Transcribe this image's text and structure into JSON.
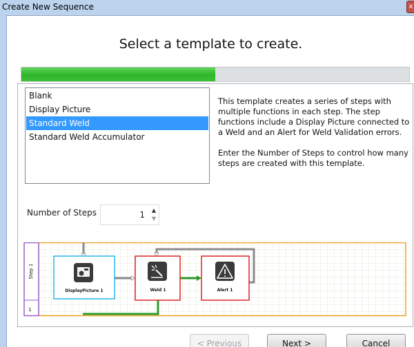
{
  "window": {
    "title": "Create New Sequence",
    "close_glyph": "x"
  },
  "heading": "Select a template to create.",
  "progress": {
    "value": 0.5
  },
  "templates": {
    "items": [
      {
        "label": "Blank"
      },
      {
        "label": "Display Picture"
      },
      {
        "label": "Standard Weld"
      },
      {
        "label": "Standard Weld Accumulator"
      }
    ],
    "selected": "Standard Weld"
  },
  "description": {
    "paragraph1": "This template creates a series of steps with multiple functions in each step.  The step functions include a Display Picture connected to a Weld and an Alert for Weld Validation errors.",
    "paragraph2": "Enter the Number of Steps to control how many steps are created with this template."
  },
  "steps": {
    "label": "Number of Steps",
    "value": "1",
    "up_glyph": "▲",
    "down_glyph": "▼"
  },
  "diagram": {
    "step_label": "Step 1",
    "step_number": "1",
    "nodes": [
      {
        "label": "DisplayPicture 1",
        "icon": "camera-icon",
        "border_color": "#29b6e8"
      },
      {
        "label": "Weld 1",
        "icon": "weld-icon",
        "border_color": "#e02020"
      },
      {
        "label": "Alert 1",
        "icon": "warning-icon",
        "border_color": "#e02020"
      }
    ],
    "colors": {
      "step_band": "#9a5ec7",
      "lane_border": "#f0a020",
      "grid": "#e3ebd6",
      "success_link": "#2a9a2a",
      "gray_link": "#8a8a8a"
    }
  },
  "buttons": {
    "previous": "< Previous",
    "next": "Next >",
    "cancel": "Cancel"
  }
}
